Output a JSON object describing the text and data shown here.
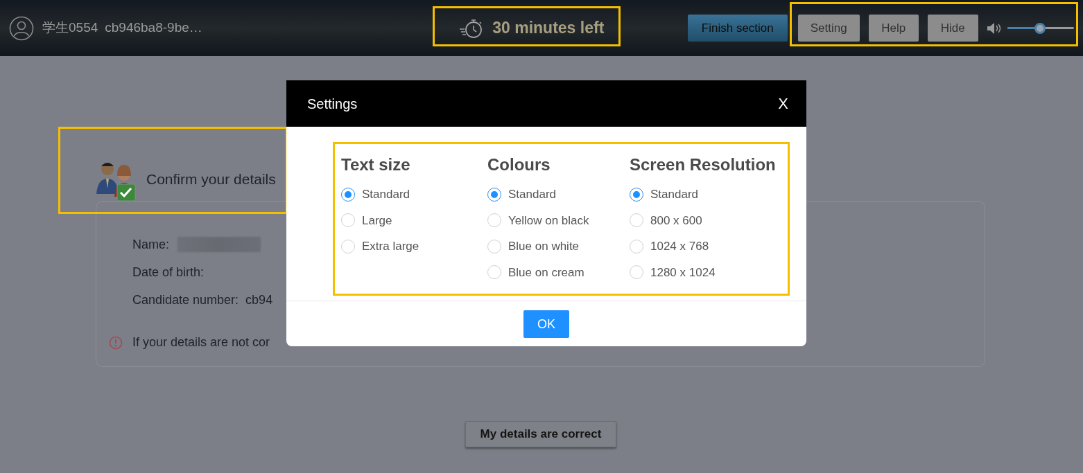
{
  "header": {
    "user_name": "学生0554",
    "user_id": "cb946ba8-9be…",
    "timer": "30 minutes left",
    "buttons": [
      {
        "label": "Finish section",
        "kind": "primary"
      },
      {
        "label": "Setting",
        "kind": "plain"
      },
      {
        "label": "Help",
        "kind": "plain"
      },
      {
        "label": "Hide",
        "kind": "plain"
      }
    ],
    "volume": {
      "level": 0.49
    }
  },
  "page": {
    "title": "Confirm your details",
    "details": [
      {
        "label": "Name:",
        "value_hidden": true
      },
      {
        "label": "Date of birth:"
      },
      {
        "label": "Candidate number:",
        "value": "cb94"
      }
    ],
    "warning": "If your details are not cor",
    "confirm_button": "My details are correct"
  },
  "dialog": {
    "title": "Settings",
    "close": "X",
    "groups": [
      {
        "title": "Text size",
        "options": [
          {
            "label": "Standard",
            "selected": true
          },
          {
            "label": "Large",
            "selected": false
          },
          {
            "label": "Extra large",
            "selected": false
          }
        ]
      },
      {
        "title": "Colours",
        "options": [
          {
            "label": "Standard",
            "selected": true
          },
          {
            "label": "Yellow on black",
            "selected": false
          },
          {
            "label": "Blue on white",
            "selected": false
          },
          {
            "label": "Blue on cream",
            "selected": false
          }
        ]
      },
      {
        "title": "Screen Resolution",
        "options": [
          {
            "label": "Standard",
            "selected": true
          },
          {
            "label": "800 x 600",
            "selected": false
          },
          {
            "label": "1024 x 768",
            "selected": false
          },
          {
            "label": "1280 x 1024",
            "selected": false
          }
        ]
      }
    ],
    "ok": "OK"
  }
}
